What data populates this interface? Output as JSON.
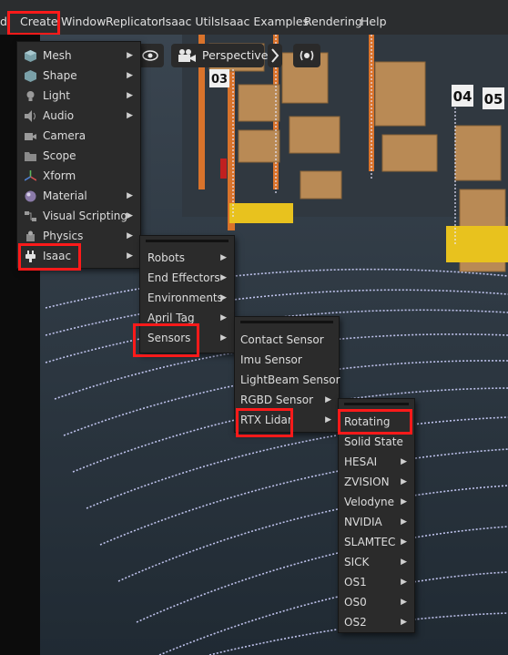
{
  "menubar": {
    "items": [
      "d",
      "Create",
      "Window",
      "Replicator",
      "Isaac Utils",
      "Isaac Examples",
      "Rendering",
      "Help"
    ]
  },
  "viewport": {
    "camera_label": "Perspective",
    "shelf_numbers": [
      "03",
      "04",
      "05"
    ]
  },
  "create_menu": {
    "items": [
      {
        "label": "Mesh",
        "icon": "cube-icon",
        "submenu": true
      },
      {
        "label": "Shape",
        "icon": "shape-icon",
        "submenu": true
      },
      {
        "label": "Light",
        "icon": "light-icon",
        "submenu": true
      },
      {
        "label": "Audio",
        "icon": "speaker-icon",
        "submenu": true
      },
      {
        "label": "Camera",
        "icon": "camera-icon",
        "submenu": false
      },
      {
        "label": "Scope",
        "icon": "folder-icon",
        "submenu": false
      },
      {
        "label": "Xform",
        "icon": "xform-icon",
        "submenu": false
      },
      {
        "label": "Material",
        "icon": "material-sphere-icon",
        "submenu": true
      },
      {
        "label": "Visual Scripting",
        "icon": "graph-icon",
        "submenu": true
      },
      {
        "label": "Physics",
        "icon": "physics-icon",
        "submenu": true
      },
      {
        "label": "Isaac",
        "icon": "plug-icon",
        "submenu": true
      }
    ]
  },
  "isaac_menu": {
    "items": [
      {
        "label": "Robots",
        "submenu": true
      },
      {
        "label": "End Effectors",
        "submenu": true
      },
      {
        "label": "Environments",
        "submenu": true
      },
      {
        "label": "April Tag",
        "submenu": true
      },
      {
        "label": "Sensors",
        "submenu": true
      }
    ]
  },
  "sensors_menu": {
    "items": [
      {
        "label": "Contact Sensor",
        "submenu": false
      },
      {
        "label": "Imu Sensor",
        "submenu": false
      },
      {
        "label": "LightBeam Sensor",
        "submenu": false
      },
      {
        "label": "RGBD Sensor",
        "submenu": true
      },
      {
        "label": "RTX Lidar",
        "submenu": true
      }
    ]
  },
  "rtx_lidar_menu": {
    "items": [
      {
        "label": "Rotating",
        "submenu": false
      },
      {
        "label": "Solid State",
        "submenu": false
      },
      {
        "label": "HESAI",
        "submenu": true
      },
      {
        "label": "ZVISION",
        "submenu": true
      },
      {
        "label": "Velodyne",
        "submenu": true
      },
      {
        "label": "NVIDIA",
        "submenu": true
      },
      {
        "label": "SLAMTEC",
        "submenu": true
      },
      {
        "label": "SICK",
        "submenu": true
      },
      {
        "label": "OS1",
        "submenu": true
      },
      {
        "label": "OS0",
        "submenu": true
      },
      {
        "label": "OS2",
        "submenu": true
      }
    ]
  },
  "colors": {
    "highlight": "#ff1a1a",
    "menu_bg": "#2b2b2b",
    "lidar": "#cfd2ff"
  }
}
